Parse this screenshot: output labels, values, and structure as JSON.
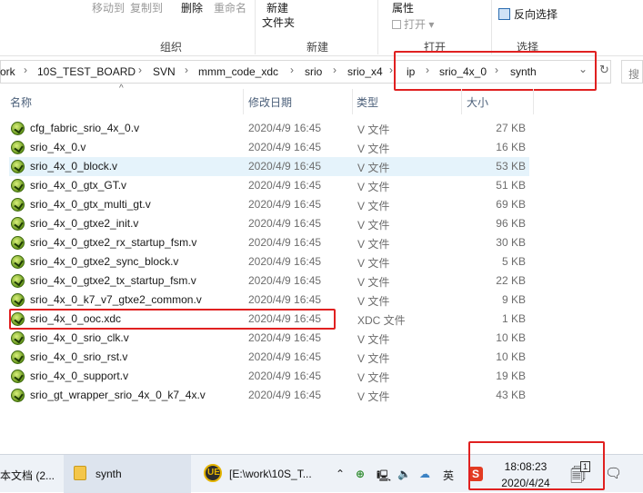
{
  "ribbon": {
    "organize": {
      "move_to": "移动到",
      "copy_to": "复制到",
      "delete": "删除",
      "rename": "重命名",
      "group_label": "组织"
    },
    "new": {
      "new_folder_line1": "新建",
      "new_folder_line2": "文件夹",
      "group_label": "新建"
    },
    "open": {
      "properties": "属性",
      "open": "打开",
      "group_label": "打开"
    },
    "select": {
      "invert": "反向选择",
      "group_label": "选择"
    }
  },
  "address": {
    "crumbs": [
      "ork",
      "10S_TEST_BOARD",
      "SVN",
      "mmm_code_xdc",
      "srio",
      "srio_x4",
      "ip",
      "srio_4x_0",
      "synth"
    ],
    "search_placeholder": "搜"
  },
  "columns": {
    "name": "名称",
    "date": "修改日期",
    "type": "类型",
    "size": "大小"
  },
  "files": [
    {
      "name": "cfg_fabric_srio_4x_0.v",
      "date": "2020/4/9 16:45",
      "type": "V 文件",
      "size": "27 KB"
    },
    {
      "name": "srio_4x_0.v",
      "date": "2020/4/9 16:45",
      "type": "V 文件",
      "size": "16 KB"
    },
    {
      "name": "srio_4x_0_block.v",
      "date": "2020/4/9 16:45",
      "type": "V 文件",
      "size": "53 KB"
    },
    {
      "name": "srio_4x_0_gtx_GT.v",
      "date": "2020/4/9 16:45",
      "type": "V 文件",
      "size": "51 KB"
    },
    {
      "name": "srio_4x_0_gtx_multi_gt.v",
      "date": "2020/4/9 16:45",
      "type": "V 文件",
      "size": "69 KB"
    },
    {
      "name": "srio_4x_0_gtxe2_init.v",
      "date": "2020/4/9 16:45",
      "type": "V 文件",
      "size": "96 KB"
    },
    {
      "name": "srio_4x_0_gtxe2_rx_startup_fsm.v",
      "date": "2020/4/9 16:45",
      "type": "V 文件",
      "size": "30 KB"
    },
    {
      "name": "srio_4x_0_gtxe2_sync_block.v",
      "date": "2020/4/9 16:45",
      "type": "V 文件",
      "size": "5 KB"
    },
    {
      "name": "srio_4x_0_gtxe2_tx_startup_fsm.v",
      "date": "2020/4/9 16:45",
      "type": "V 文件",
      "size": "22 KB"
    },
    {
      "name": "srio_4x_0_k7_v7_gtxe2_common.v",
      "date": "2020/4/9 16:45",
      "type": "V 文件",
      "size": "9 KB"
    },
    {
      "name": "srio_4x_0_ooc.xdc",
      "date": "2020/4/9 16:45",
      "type": "XDC 文件",
      "size": "1 KB"
    },
    {
      "name": "srio_4x_0_srio_clk.v",
      "date": "2020/4/9 16:45",
      "type": "V 文件",
      "size": "10 KB"
    },
    {
      "name": "srio_4x_0_srio_rst.v",
      "date": "2020/4/9 16:45",
      "type": "V 文件",
      "size": "10 KB"
    },
    {
      "name": "srio_4x_0_support.v",
      "date": "2020/4/9 16:45",
      "type": "V 文件",
      "size": "19 KB"
    },
    {
      "name": "srio_gt_wrapper_srio_4x_0_k7_4x.v",
      "date": "2020/4/9 16:45",
      "type": "V 文件",
      "size": "43 KB"
    }
  ],
  "taskbar": {
    "item1": "本文档 (2...",
    "item2": "synth",
    "item3": "[E:\\work\\10S_T...",
    "ime": "英",
    "ime_logo": "S",
    "time": "18:08:23",
    "date": "2020/4/24",
    "notif_count": "1",
    "ue_logo": "UE"
  },
  "colors": {
    "highlight": "#e02020",
    "selection": "#e5f3fb"
  }
}
